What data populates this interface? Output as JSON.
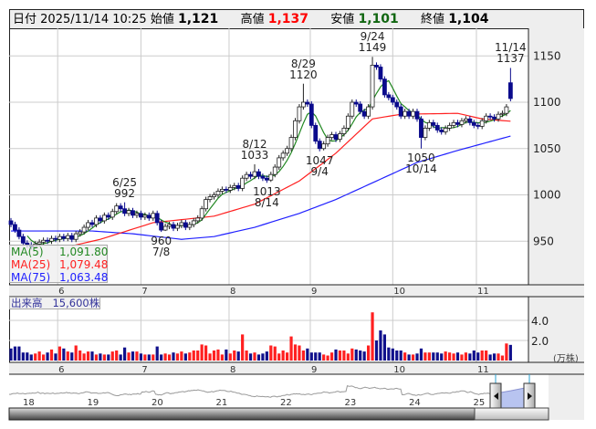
{
  "header": {
    "date_label": "日付",
    "date": "2025/11/14 10:25",
    "open_label": "始値",
    "open": "1,121",
    "high_label": "高値",
    "high": "1,137",
    "low_label": "安値",
    "low": "1,101",
    "close_label": "終値",
    "close": "1,104"
  },
  "legend": {
    "ma5_label": "MA(5)",
    "ma5": "1,091.80",
    "ma25_label": "MA(25)",
    "ma25": "1,079.48",
    "ma75_label": "MA(75)",
    "ma75": "1,063.48"
  },
  "volume_box": {
    "label": "出来高",
    "value": "15,600株"
  },
  "colors": {
    "up_candle": "#ffffff",
    "down_candle": "#0a0a8c",
    "vol_up": "#ff2020",
    "vol_down": "#10108c",
    "vol_flat": "#999999",
    "ma5": "#228822",
    "ma25": "#ff2020",
    "ma75": "#2020ff",
    "high_text": "#ff0000",
    "low_text": "#116611"
  },
  "chart_data": {
    "type": "candlestick",
    "price_ticks": [
      1150,
      1100,
      1050,
      1000,
      950
    ],
    "ylim": [
      907,
      1180
    ],
    "month_ticks": [
      {
        "label": "6",
        "index": 11.5
      },
      {
        "label": "7",
        "index": 32
      },
      {
        "label": "8",
        "index": 53.7
      },
      {
        "label": "9",
        "index": 73.7
      },
      {
        "label": "10",
        "index": 94
      },
      {
        "label": "11",
        "index": 114.6
      }
    ],
    "open": [
      972,
      968,
      962,
      955,
      948,
      946,
      944,
      947,
      949,
      951,
      950,
      953,
      952,
      955,
      953,
      956,
      952,
      958,
      960,
      965,
      970,
      968,
      975,
      972,
      978,
      976,
      982,
      988,
      985,
      980,
      983,
      978,
      980,
      976,
      978,
      975,
      980,
      970,
      962,
      966,
      968,
      964,
      967,
      970,
      965,
      968,
      972,
      975,
      985,
      995,
      998,
      1000,
      1004,
      1006,
      1005,
      1008,
      1010,
      1007,
      1018,
      1022,
      1020,
      1025,
      1020,
      1018,
      1016,
      1022,
      1030,
      1040,
      1045,
      1050,
      1062,
      1080,
      1095,
      1100,
      1098,
      1075,
      1058,
      1050,
      1055,
      1062,
      1065,
      1060,
      1066,
      1072,
      1085,
      1100,
      1098,
      1090,
      1085,
      1095,
      1140,
      1138,
      1125,
      1108,
      1105,
      1100,
      1095,
      1085,
      1090,
      1085,
      1090,
      1082,
      1062,
      1072,
      1078,
      1075,
      1070,
      1068,
      1072,
      1075,
      1078,
      1076,
      1080,
      1082,
      1078,
      1075,
      1074,
      1080,
      1085,
      1084,
      1082,
      1087,
      1088,
      1121
    ],
    "high": [
      975,
      971,
      965,
      958,
      951,
      949,
      950,
      952,
      954,
      954,
      956,
      956,
      958,
      958,
      959,
      959,
      961,
      963,
      968,
      973,
      973,
      978,
      978,
      981,
      981,
      985,
      991,
      991,
      992,
      986,
      986,
      983,
      983,
      981,
      981,
      983,
      983,
      973,
      969,
      971,
      971,
      970,
      973,
      973,
      971,
      975,
      978,
      988,
      998,
      1001,
      1003,
      1007,
      1009,
      1009,
      1011,
      1013,
      1013,
      1021,
      1025,
      1025,
      1033,
      1028,
      1023,
      1021,
      1025,
      1033,
      1043,
      1048,
      1053,
      1065,
      1083,
      1098,
      1120,
      1103,
      1101,
      1078,
      1061,
      1058,
      1065,
      1068,
      1068,
      1069,
      1075,
      1088,
      1103,
      1103,
      1101,
      1093,
      1098,
      1149,
      1143,
      1141,
      1128,
      1111,
      1108,
      1103,
      1098,
      1093,
      1093,
      1093,
      1093,
      1085,
      1075,
      1081,
      1081,
      1078,
      1073,
      1075,
      1078,
      1081,
      1081,
      1083,
      1085,
      1085,
      1081,
      1078,
      1083,
      1088,
      1088,
      1087,
      1090,
      1091,
      1098,
      1137
    ],
    "low": [
      965,
      959,
      952,
      945,
      943,
      941,
      941,
      944,
      946,
      947,
      947,
      949,
      949,
      950,
      950,
      949,
      949,
      955,
      957,
      962,
      965,
      965,
      969,
      969,
      973,
      973,
      979,
      982,
      977,
      977,
      975,
      975,
      973,
      973,
      972,
      972,
      967,
      960,
      961,
      963,
      961,
      961,
      964,
      962,
      962,
      965,
      969,
      972,
      982,
      992,
      995,
      997,
      1001,
      1002,
      1002,
      1005,
      1004,
      1004,
      1015,
      1017,
      1017,
      1017,
      1015,
      1013,
      1014,
      1019,
      1027,
      1037,
      1042,
      1047,
      1059,
      1077,
      1092,
      1095,
      1072,
      1055,
      1047,
      1048,
      1052,
      1059,
      1057,
      1057,
      1063,
      1069,
      1082,
      1095,
      1087,
      1082,
      1082,
      1092,
      1135,
      1122,
      1105,
      1102,
      1097,
      1092,
      1082,
      1082,
      1082,
      1082,
      1079,
      1050,
      1059,
      1069,
      1072,
      1067,
      1065,
      1065,
      1069,
      1072,
      1073,
      1073,
      1077,
      1075,
      1072,
      1071,
      1071,
      1077,
      1081,
      1079,
      1079,
      1084,
      1085,
      1101
    ],
    "close": [
      968,
      962,
      955,
      948,
      946,
      944,
      947,
      949,
      951,
      950,
      953,
      952,
      955,
      953,
      956,
      952,
      958,
      960,
      965,
      970,
      968,
      975,
      972,
      978,
      976,
      982,
      988,
      985,
      980,
      983,
      978,
      980,
      976,
      978,
      975,
      980,
      970,
      962,
      966,
      968,
      964,
      967,
      970,
      965,
      968,
      972,
      975,
      985,
      995,
      998,
      1000,
      1004,
      1006,
      1005,
      1008,
      1010,
      1007,
      1018,
      1022,
      1020,
      1025,
      1020,
      1018,
      1016,
      1022,
      1030,
      1040,
      1045,
      1050,
      1062,
      1080,
      1095,
      1100,
      1098,
      1075,
      1058,
      1050,
      1055,
      1062,
      1065,
      1060,
      1066,
      1072,
      1085,
      1100,
      1098,
      1090,
      1085,
      1095,
      1140,
      1138,
      1125,
      1108,
      1105,
      1100,
      1095,
      1085,
      1090,
      1085,
      1090,
      1082,
      1062,
      1072,
      1078,
      1075,
      1070,
      1068,
      1072,
      1075,
      1078,
      1076,
      1080,
      1082,
      1078,
      1075,
      1074,
      1080,
      1085,
      1084,
      1082,
      1087,
      1088,
      1095,
      1104
    ],
    "ma25": [
      [
        15,
        945
      ],
      [
        22,
        952
      ],
      [
        35,
        970
      ],
      [
        50,
        977
      ],
      [
        60,
        990
      ],
      [
        71,
        1015
      ],
      [
        80,
        1045
      ],
      [
        89,
        1082
      ],
      [
        96,
        1087
      ],
      [
        110,
        1088
      ],
      [
        116,
        1082
      ],
      [
        123,
        1079.48
      ]
    ],
    "ma75": [
      [
        0,
        961
      ],
      [
        20,
        961
      ],
      [
        30,
        958
      ],
      [
        42,
        952
      ],
      [
        50,
        955
      ],
      [
        60,
        965
      ],
      [
        71,
        980
      ],
      [
        80,
        995
      ],
      [
        90,
        1015
      ],
      [
        100,
        1035
      ],
      [
        110,
        1048
      ],
      [
        123,
        1063.48
      ]
    ],
    "annotations": [
      {
        "date": "6/25",
        "value": "992",
        "pos": "above"
      },
      {
        "date": "7/8",
        "value": "960",
        "pos": "below"
      },
      {
        "date": "8/12",
        "value": "1033",
        "pos": "above"
      },
      {
        "date": "8/14",
        "value": "1013",
        "pos": "below"
      },
      {
        "date": "8/29",
        "value": "1120",
        "pos": "above"
      },
      {
        "date": "9/4",
        "value": "1047",
        "pos": "below"
      },
      {
        "date": "9/24",
        "value": "1149",
        "pos": "above"
      },
      {
        "date": "10/14",
        "value": "1050",
        "pos": "below"
      },
      {
        "date": "11/14",
        "value": "1137",
        "pos": "above"
      }
    ],
    "volume": {
      "unit": "(万株)",
      "ticks": [
        {
          "label": "4.0",
          "value": 4
        },
        {
          "label": "2.0",
          "value": 2
        }
      ],
      "values": [
        1.2,
        1.4,
        1.4,
        0.8,
        0.8,
        0.6,
        0.7,
        0.9,
        0.6,
        0.8,
        1.1,
        0.7,
        1.4,
        1.2,
        0.9,
        0.8,
        1.5,
        1.0,
        0.7,
        0.9,
        0.9,
        0.6,
        0.7,
        0.6,
        0.6,
        0.9,
        1.0,
        0.6,
        1.3,
        0.8,
        0.9,
        0.9,
        0.7,
        0.6,
        0.6,
        0.6,
        1.4,
        0.6,
        0.7,
        0.6,
        0.8,
        0.7,
        0.9,
        0.7,
        0.8,
        1.0,
        1.0,
        1.6,
        1.5,
        0.7,
        1.0,
        1.1,
        0.6,
        1.1,
        0.7,
        1.0,
        0.9,
        2.6,
        1.0,
        0.7,
        0.8,
        0.6,
        0.7,
        0.9,
        1.5,
        1.4,
        0.7,
        1.0,
        0.8,
        2.4,
        1.6,
        1.5,
        1.0,
        1.2,
        0.8,
        0.8,
        0.8,
        0.6,
        0.5,
        0.8,
        1.1,
        1.0,
        1.0,
        0.7,
        1.2,
        1.1,
        1.0,
        0.9,
        1.5,
        4.8,
        2.0,
        3.0,
        2.6,
        1.3,
        1.2,
        1.0,
        1.0,
        0.8,
        0.6,
        0.6,
        0.7,
        1.2,
        0.8,
        0.8,
        0.8,
        0.8,
        0.7,
        0.9,
        0.8,
        0.7,
        0.8,
        0.6,
        0.8,
        0.7,
        1.0,
        0.8,
        1.0,
        1.0,
        0.6,
        0.7,
        0.7,
        0.5,
        1.7,
        1.56
      ]
    },
    "navigator_years": [
      "18",
      "19",
      "20",
      "21",
      "22",
      "23",
      "24",
      "25"
    ]
  }
}
